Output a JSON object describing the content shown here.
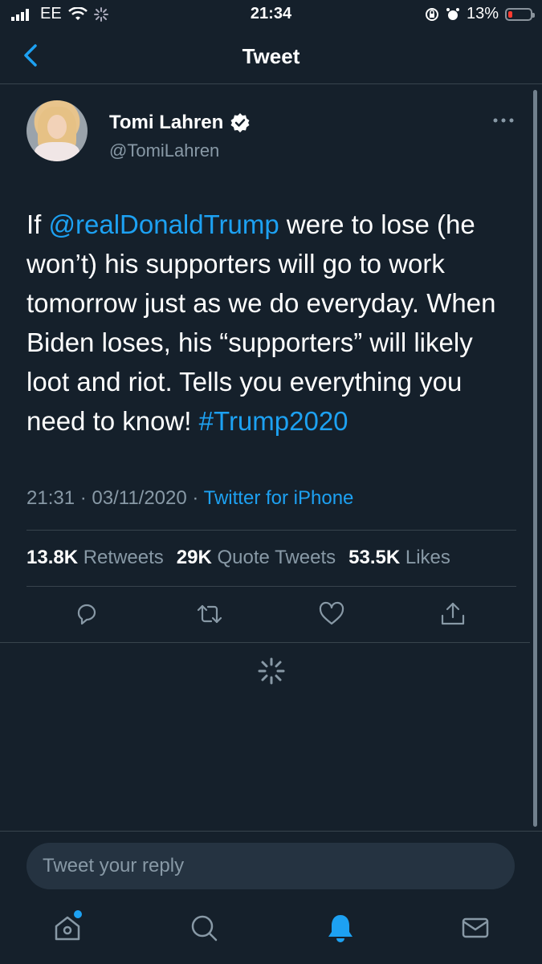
{
  "status_bar": {
    "carrier": "EE",
    "time": "21:34",
    "battery_percent": "13%"
  },
  "nav": {
    "title": "Tweet"
  },
  "tweet": {
    "author_name": "Tomi Lahren",
    "author_handle": "@TomiLahren",
    "text_part1": "If ",
    "mention": "@realDonaldTrump",
    "text_part2": " were to lose (he won’t) his supporters will go to work tomorrow just as we do everyday. When Biden loses, his “supporters” will likely loot and riot. Tells you everything you need to know! ",
    "hashtag": "#Trump2020",
    "time": "21:31",
    "date": "03/11/2020",
    "source": "Twitter for iPhone",
    "stats": {
      "retweets_count": "13.8K",
      "retweets_label": "Retweets",
      "quotes_count": "29K",
      "quotes_label": "Quote Tweets",
      "likes_count": "53.5K",
      "likes_label": "Likes"
    }
  },
  "reply": {
    "placeholder": "Tweet your reply"
  },
  "tab_bar": {
    "items": [
      "home-icon",
      "search-icon",
      "notifications-icon",
      "messages-icon"
    ],
    "active": "notifications-icon"
  },
  "colors": {
    "background": "#15202b",
    "accent": "#1da1f2",
    "secondary_text": "#8899a6",
    "divider": "#38444d"
  }
}
